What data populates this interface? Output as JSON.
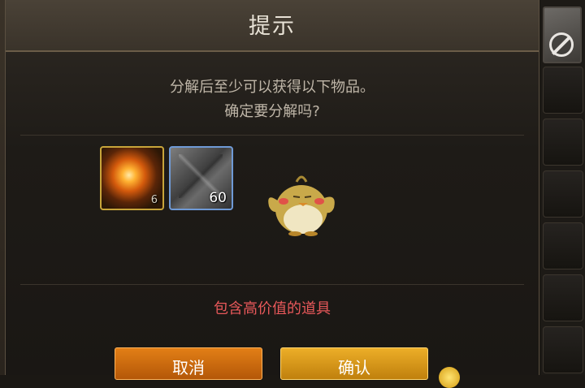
{
  "dialog": {
    "title": "提示",
    "message_line1": "分解后至少可以获得以下物品。",
    "message_line2": "确定要分解吗?",
    "warning": "包含高价值的道具",
    "items": [
      {
        "icon": "fire-orb-icon",
        "count": "6"
      },
      {
        "icon": "crystal-cubes-icon",
        "count": "60"
      }
    ],
    "buttons": {
      "cancel": "取消",
      "confirm": "确认"
    }
  },
  "colors": {
    "warning_text": "#e8585a",
    "cancel_button": "#d46f10",
    "confirm_button": "#dea022",
    "item_fire_border": "#c8a53a",
    "item_gem_border": "#6f9ad6"
  }
}
